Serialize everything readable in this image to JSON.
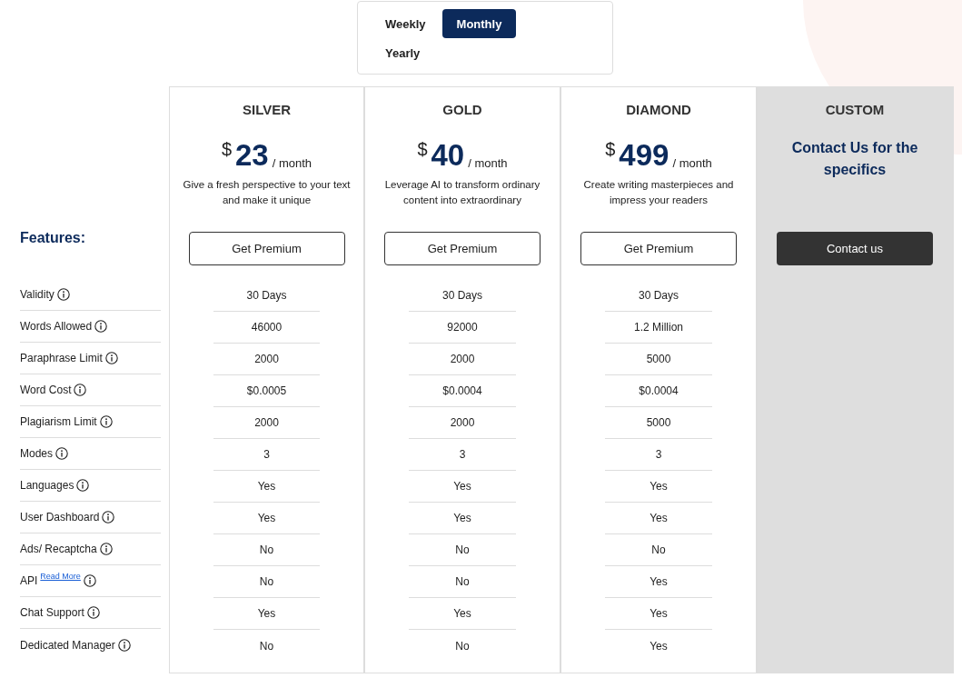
{
  "billing_toggle": [
    {
      "label": "Weekly",
      "selected": false
    },
    {
      "label": "Monthly",
      "selected": true
    },
    {
      "label": "Yearly",
      "selected": false
    }
  ],
  "features_heading": "Features:",
  "features": [
    {
      "name": "Validity"
    },
    {
      "name": "Words Allowed"
    },
    {
      "name": "Paraphrase Limit"
    },
    {
      "name": "Word Cost"
    },
    {
      "name": "Plagiarism Limit"
    },
    {
      "name": "Modes"
    },
    {
      "name": "Languages"
    },
    {
      "name": "User Dashboard"
    },
    {
      "name": "Ads/ Recaptcha"
    },
    {
      "name": "API",
      "link": "Read More"
    },
    {
      "name": "Chat Support"
    },
    {
      "name": "Dedicated Manager"
    }
  ],
  "plans": [
    {
      "kind": "plan",
      "name": "SILVER",
      "currency": "$",
      "price": "23",
      "period": "/ month",
      "description": "Give a fresh perspective to your text and make it unique",
      "button": "Get Premium",
      "values": [
        "30 Days",
        "46000",
        "2000",
        "$0.0005",
        "2000",
        "3",
        "Yes",
        "Yes",
        "No",
        "No",
        "Yes",
        "No"
      ]
    },
    {
      "kind": "plan",
      "name": "GOLD",
      "currency": "$",
      "price": "40",
      "period": "/ month",
      "description": "Leverage AI to transform ordinary content into extraordinary",
      "button": "Get Premium",
      "values": [
        "30 Days",
        "92000",
        "2000",
        "$0.0004",
        "2000",
        "3",
        "Yes",
        "Yes",
        "No",
        "No",
        "Yes",
        "No"
      ]
    },
    {
      "kind": "plan",
      "name": "DIAMOND",
      "currency": "$",
      "price": "499",
      "period": "/ month",
      "description": "Create writing masterpieces and impress your readers",
      "button": "Get Premium",
      "values": [
        "30 Days",
        "1.2 Million",
        "5000",
        "$0.0004",
        "5000",
        "3",
        "Yes",
        "Yes",
        "No",
        "Yes",
        "Yes",
        "Yes"
      ]
    },
    {
      "kind": "custom",
      "name": "CUSTOM",
      "tagline": "Contact Us for the specifics",
      "button": "Contact us"
    }
  ]
}
